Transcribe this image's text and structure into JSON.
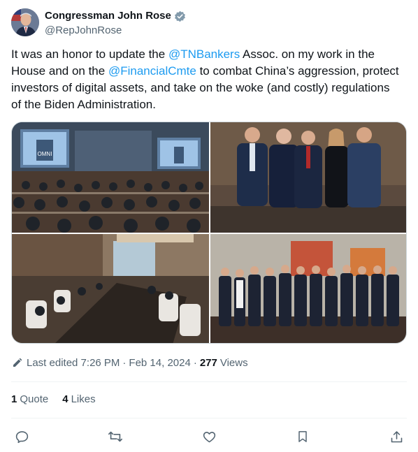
{
  "author": {
    "display_name": "Congressman John Rose",
    "handle": "@RepJohnRose"
  },
  "tweet": {
    "text_1": "It was an honor to update the ",
    "mention_1": "@TNBankers",
    "text_2": " Assoc. on my work in the House and on the ",
    "mention_2": "@FinancialCmte",
    "text_3": " to combat China’s aggression, protect investors of digital assets, and take on the woke (and costly) regulations of the Biden Administration."
  },
  "media": {
    "photos": [
      {
        "icon": "conference-room-photo"
      },
      {
        "icon": "group-portrait-photo"
      },
      {
        "icon": "meeting-table-photo"
      },
      {
        "icon": "large-group-photo"
      }
    ],
    "screen_text": "OMNI"
  },
  "meta": {
    "edited_label": "Last edited 7:26 PM",
    "dot": "·",
    "date": "Feb 14, 2024",
    "views_count": "277",
    "views_label": "Views"
  },
  "stats": {
    "quote_count": "1",
    "quote_label": "Quote",
    "likes_count": "4",
    "likes_label": "Likes"
  },
  "colors": {
    "accent": "#1d9bf0",
    "text": "#0f1419",
    "secondary": "#536471",
    "border": "#cfd9de"
  }
}
